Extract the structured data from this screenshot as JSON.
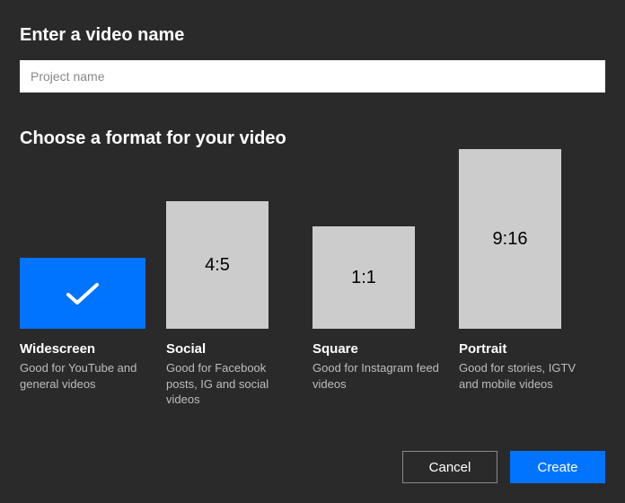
{
  "name_section": {
    "label": "Enter a video name",
    "placeholder": "Project name",
    "value": ""
  },
  "format_section": {
    "label": "Choose a format for your video",
    "selected_index": 0,
    "options": [
      {
        "ratio_label": "",
        "title": "Widescreen",
        "desc": "Good for YouTube and general videos"
      },
      {
        "ratio_label": "4:5",
        "title": "Social",
        "desc": "Good for Facebook posts, IG and social videos"
      },
      {
        "ratio_label": "1:1",
        "title": "Square",
        "desc": "Good for Instagram feed videos"
      },
      {
        "ratio_label": "9:16",
        "title": "Portrait",
        "desc": "Good for stories, IGTV and mobile videos"
      }
    ]
  },
  "footer": {
    "cancel": "Cancel",
    "create": "Create"
  },
  "colors": {
    "accent": "#0073ff",
    "bg": "#2a2a2a",
    "thumb_bg": "#cccccc"
  }
}
